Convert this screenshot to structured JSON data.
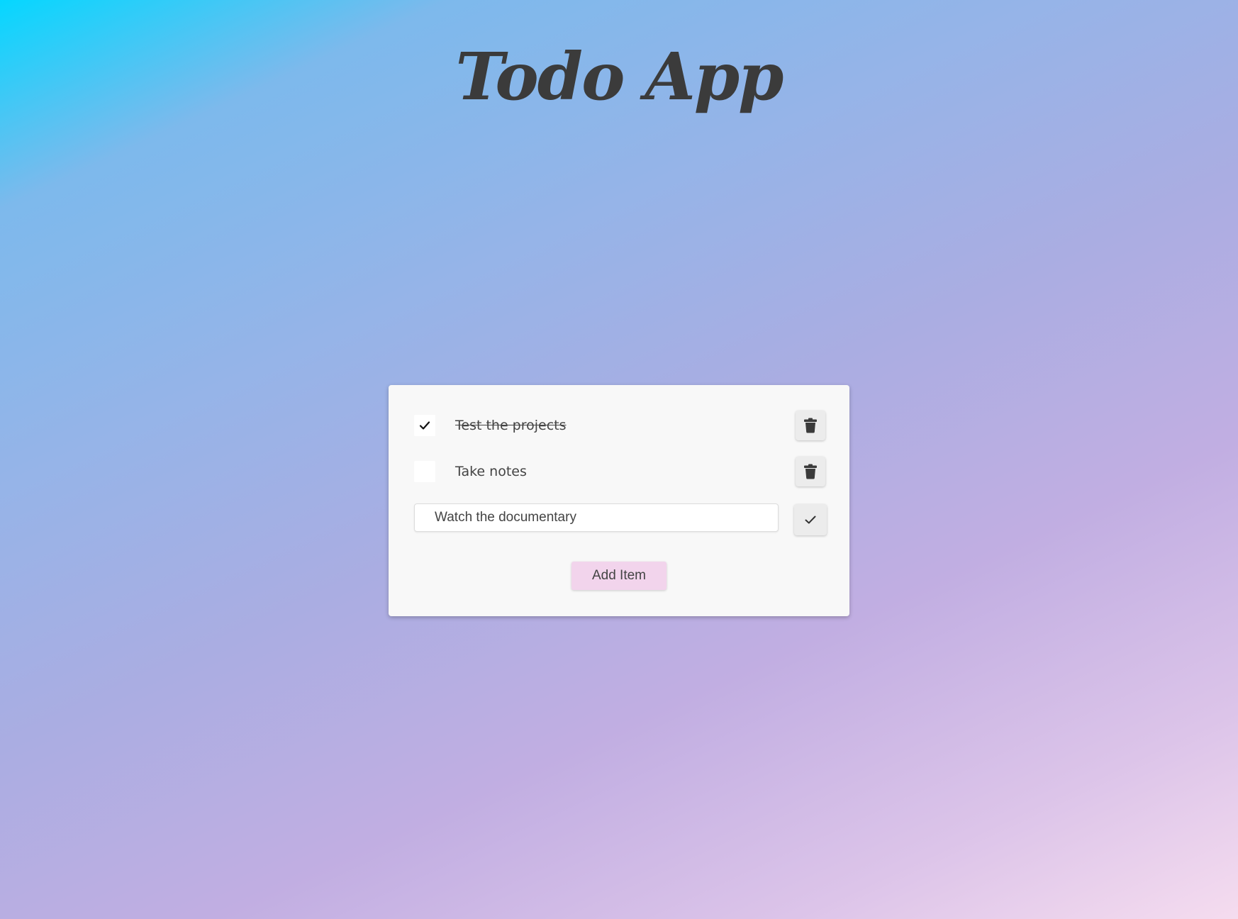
{
  "app": {
    "title": "Todo App"
  },
  "todos": [
    {
      "text": "Test the projects",
      "completed": true,
      "delete_icon": "trash-icon"
    },
    {
      "text": "Take notes",
      "completed": false,
      "delete_icon": "trash-icon"
    }
  ],
  "edit": {
    "value": "Watch the documentary",
    "save_icon": "check-icon"
  },
  "actions": {
    "add_label": "Add Item"
  },
  "colors": {
    "card_background": "#f8f8f8",
    "add_button": "#f2d4ec",
    "icon_button": "#ececec",
    "text": "#3b3b3b"
  }
}
